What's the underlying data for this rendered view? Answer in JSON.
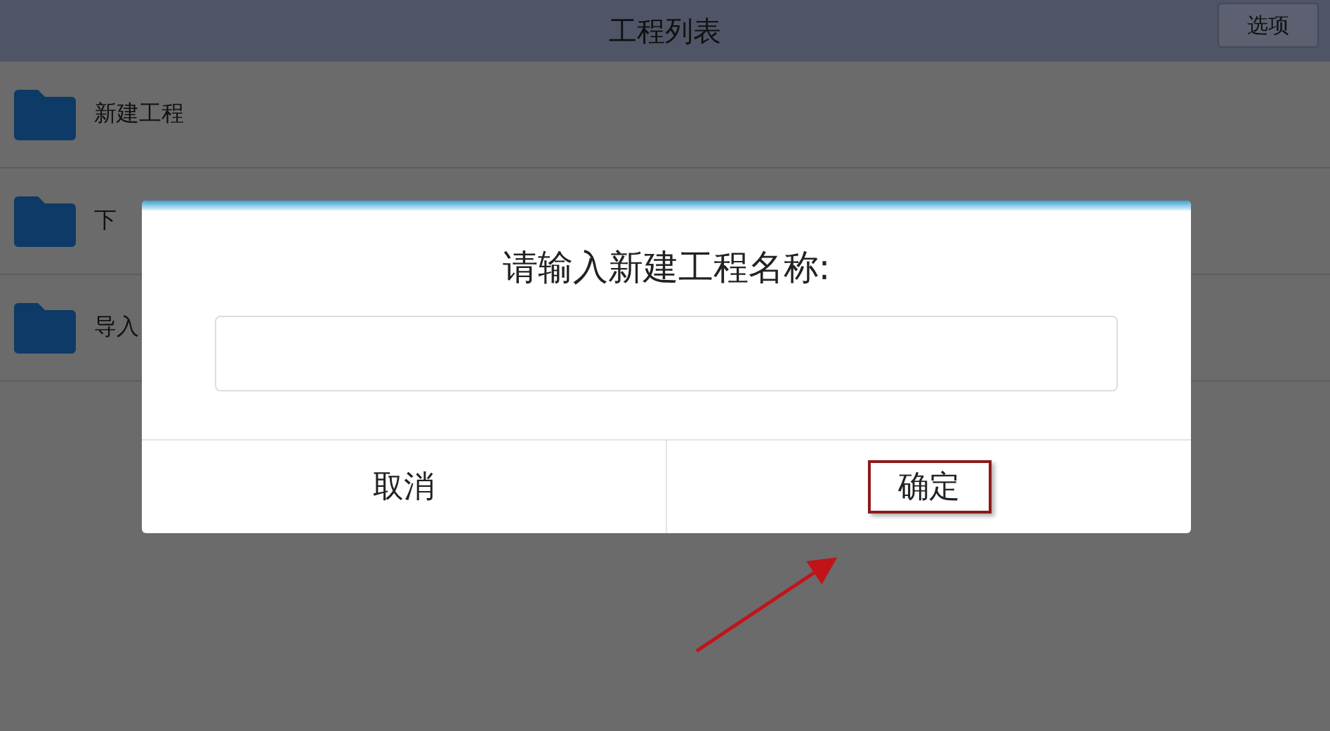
{
  "header": {
    "title": "工程列表",
    "options_button": "选项"
  },
  "projects": [
    {
      "label": "新建工程"
    },
    {
      "label": "下"
    },
    {
      "label": "导入"
    }
  ],
  "dialog": {
    "title": "请输入新建工程名称:",
    "buttons": [
      {
        "label": "取消",
        "highlighted": false
      },
      {
        "label": "确定",
        "highlighted": true
      }
    ]
  }
}
